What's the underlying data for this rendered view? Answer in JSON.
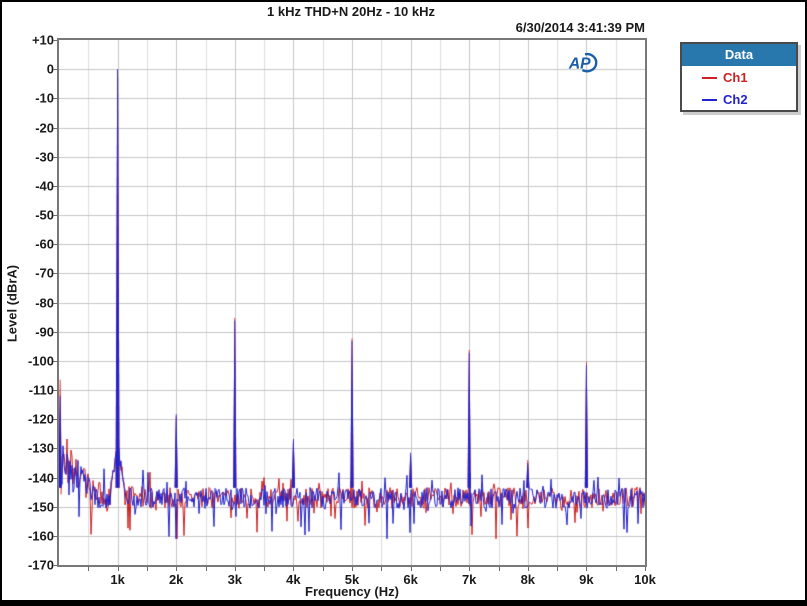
{
  "header": {
    "title": "1 kHz THD+N 20Hz - 10 kHz",
    "timestamp": "6/30/2014 3:41:39 PM"
  },
  "logo": {
    "text": "AP",
    "color": "#1a5dab"
  },
  "legend": {
    "header": "Data",
    "header_bg": "#2878ae",
    "items": [
      {
        "label": "Ch1",
        "color": "#cc2222"
      },
      {
        "label": "Ch2",
        "color": "#2323cd"
      }
    ]
  },
  "chart_data": {
    "type": "line",
    "title": "1 kHz THD+N 20Hz - 10 kHz",
    "xlabel": "Frequency (Hz)",
    "ylabel": "Level (dBrA)",
    "xlim_hz": [
      20,
      10000
    ],
    "ylim_db": [
      -170,
      10
    ],
    "x_scale": "linear",
    "grid": {
      "major_color": "#c6c6c6",
      "minor_color": "#dcdcdc",
      "minor_x_step_hz": 500
    },
    "x_tick_hz": [
      1000,
      2000,
      3000,
      4000,
      5000,
      6000,
      7000,
      8000,
      9000,
      10000
    ],
    "x_tick_labels": [
      "1k",
      "2k",
      "3k",
      "4k",
      "5k",
      "6k",
      "7k",
      "8k",
      "9k",
      "10k"
    ],
    "y_tick_db": [
      10,
      0,
      -10,
      -20,
      -30,
      -40,
      -50,
      -60,
      -70,
      -80,
      -90,
      -100,
      -110,
      -120,
      -130,
      -140,
      -150,
      -160,
      -170
    ],
    "y_tick_labels": [
      "+10",
      "0",
      "-10",
      "-20",
      "-30",
      "-40",
      "-50",
      "-60",
      "-70",
      "-80",
      "-90",
      "-100",
      "-110",
      "-120",
      "-130",
      "-140",
      "-150",
      "-160",
      "-170"
    ],
    "series": [
      {
        "name": "Ch1",
        "color": "#cc2222",
        "seed": 7,
        "noise_floor_db": -147,
        "peaks_hz_db": [
          [
            20,
            -106.5
          ],
          [
            1000,
            0
          ],
          [
            2000,
            -119
          ],
          [
            3000,
            -85.3
          ],
          [
            4000,
            -127.5
          ],
          [
            5000,
            -92.3
          ],
          [
            6000,
            -133
          ],
          [
            7000,
            -96.3
          ],
          [
            8000,
            -134
          ],
          [
            9000,
            -100.3
          ]
        ]
      },
      {
        "name": "Ch2",
        "color": "#2323cd",
        "seed": 13,
        "noise_floor_db": -147,
        "peaks_hz_db": [
          [
            20,
            -112
          ],
          [
            1000,
            0
          ],
          [
            2000,
            -118.2
          ],
          [
            3000,
            -86.2
          ],
          [
            4000,
            -126.8
          ],
          [
            5000,
            -93.2
          ],
          [
            6000,
            -131.5
          ],
          [
            7000,
            -97.2
          ],
          [
            8000,
            -135
          ],
          [
            9000,
            -101.3
          ]
        ]
      }
    ],
    "noise": {
      "jitter_db": 6.5,
      "low_freq_rise_below_hz": 650,
      "low_freq_rise_db": 16,
      "skirt_center_hz": 1000,
      "skirt_half_width_hz": 120,
      "skirt_top_db": -129,
      "floor_min_db": -161,
      "floor_max_db": -122
    }
  }
}
